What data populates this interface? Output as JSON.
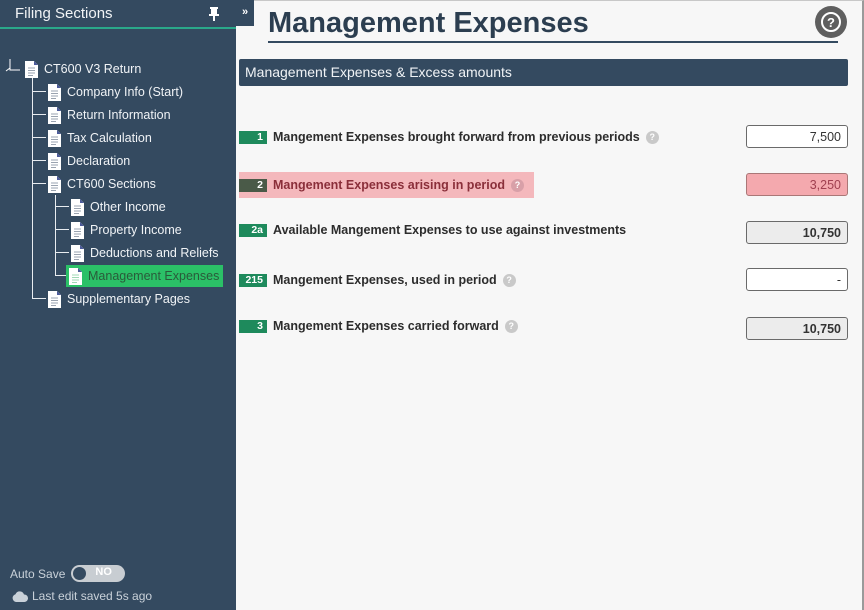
{
  "sidebar": {
    "title": "Filing Sections",
    "pin_icon": "pin-icon",
    "tree": {
      "root": "CT600 V3 Return",
      "items": [
        {
          "label": "Company Info (Start)"
        },
        {
          "label": "Return Information"
        },
        {
          "label": "Tax Calculation"
        },
        {
          "label": "Declaration"
        },
        {
          "label": "CT600 Sections",
          "children": [
            {
              "label": "Other Income"
            },
            {
              "label": "Property Income"
            },
            {
              "label": "Deductions and Reliefs"
            },
            {
              "label": "Management Expenses",
              "selected": true
            }
          ]
        },
        {
          "label": "Supplementary Pages"
        }
      ]
    },
    "autosave": {
      "label": "Auto Save",
      "toggle": "NO"
    },
    "last_saved": "Last edit saved 5s ago"
  },
  "expand_label": "»",
  "main": {
    "title": "Management Expenses",
    "help_icon": "?",
    "section_title": "Management Expenses & Excess amounts",
    "rows": [
      {
        "box": "1",
        "label": "Mangement Expenses brought forward from previous periods",
        "info": true,
        "value": "7,500",
        "state": "editable"
      },
      {
        "box": "2",
        "label": "Mangement Expenses arising in period",
        "info": true,
        "value": "3,250",
        "state": "error"
      },
      {
        "box": "2a",
        "label": "Available Mangement Expenses to use against investments",
        "info": false,
        "value": "10,750",
        "state": "readonly"
      },
      {
        "box": "215",
        "label": "Mangement Expenses, used in period",
        "info": true,
        "value": "-",
        "state": "editable"
      },
      {
        "box": "3",
        "label": "Mangement Expenses carried forward",
        "info": true,
        "value": "10,750",
        "state": "readonly"
      }
    ]
  },
  "colors": {
    "sidebar_bg": "#344a60",
    "accent_green": "#2bc067",
    "box_green": "#1e8a5c",
    "error_bg": "#f4b8bc"
  }
}
